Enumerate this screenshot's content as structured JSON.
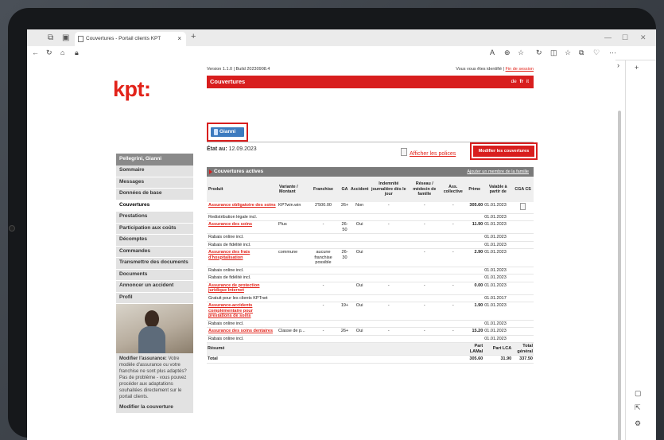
{
  "browser": {
    "tab_title": "Couvertures - Portail clients KPT",
    "tab_close": "×",
    "new_tab": "+",
    "min": "—",
    "max": "☐",
    "close": "✕"
  },
  "header": {
    "logo": "kpt:",
    "version": "Version 1.1.0 | Build 20230908.4",
    "identified_text": "Vous vous êtes identifié |",
    "logout": "Fin de session",
    "page_title": "Couvertures",
    "lang_de": "de",
    "lang_fr": "fr",
    "lang_it": "it"
  },
  "nav": {
    "user": "Pellegrini, Gianni",
    "items": [
      {
        "label": "Sommaire"
      },
      {
        "label": "Messages"
      },
      {
        "label": "Données de base"
      },
      {
        "label": "Couvertures",
        "active": true
      },
      {
        "label": "Prestations"
      },
      {
        "label": "Participation aux coûts"
      },
      {
        "label": "Décomptes"
      },
      {
        "label": "Commandes"
      },
      {
        "label": "Transmettre des documents"
      },
      {
        "label": "Documents"
      },
      {
        "label": "Annoncer un accident"
      },
      {
        "label": "Profil"
      }
    ],
    "promo_title": "Modifier l'assurance:",
    "promo_text": "Votre modèle d'assurance ou votre franchise ne sont plus adaptés? Pas de problème - vous pouvez procéder aux adaptations souhaitées directement sur le portail clients.",
    "promo_link": "Modifier la couverture"
  },
  "content": {
    "person_tab": "Gianni",
    "etat_label": "État au:",
    "etat_date": "12.09.2023",
    "afficher": "Afficher les polices",
    "modify_button": "Modifier les couvertures",
    "table_title": "Couvertures actives",
    "add_member": "Ajouter un membre de la famille",
    "columns": [
      "Produit",
      "Variante / Montant",
      "Franchise",
      "GA",
      "Accident",
      "Indemnité journalière dès le jour",
      "Réseau / médecin de famille",
      "Ass. collective",
      "Prime",
      "Valable à partir de",
      "CGA CS"
    ],
    "rows": [
      {
        "product": "Assurance obligatoire des soins",
        "link": true,
        "variant": "KPTwin.win",
        "franchise": "2'500.00",
        "ga": "26+",
        "accident": "Non",
        "indem": "-",
        "reseau": "-",
        "ass": "-",
        "prime": "305.60",
        "valable": "01.01.2023",
        "cga": true
      },
      {
        "product": "Redistribution légale incl.",
        "link": false,
        "valable": "01.01.2023"
      },
      {
        "product": "Assurance des soins",
        "link": true,
        "variant": "Plus",
        "franchise": "-",
        "ga": "26-50",
        "accident": "Oui",
        "indem": "-",
        "reseau": "-",
        "ass": "-",
        "prime": "11.90",
        "valable": "01.01.2023"
      },
      {
        "product": "Rabais online incl.",
        "link": false,
        "valable": "01.01.2023"
      },
      {
        "product": "Rabais de fidélité incl.",
        "link": false,
        "valable": "01.01.2023"
      },
      {
        "product": "Assurance des frais d'hospitalisation",
        "link": true,
        "variant": "commune",
        "franchise": "aucune franchise possible",
        "ga": "26-30",
        "accident": "Oui",
        "indem": "",
        "reseau": "-",
        "ass": "-",
        "prime": "2.90",
        "valable": "01.01.2023"
      },
      {
        "product": "Rabais online incl.",
        "link": false,
        "valable": "01.01.2023"
      },
      {
        "product": "Rabais de fidélité incl.",
        "link": false,
        "valable": "01.01.2023"
      },
      {
        "product": "Assurance de protection juridique Internet",
        "link": true,
        "variant": "",
        "franchise": "-",
        "ga": "",
        "accident": "Oui",
        "indem": "-",
        "reseau": "-",
        "ass": "-",
        "prime": "0.00",
        "valable": "01.01.2023"
      },
      {
        "product": "Gratuit pour les clients KPTnet",
        "link": false,
        "valable": "01.01.2017"
      },
      {
        "product": "Assurance-accidents complémentaire pour prestations de soins",
        "link": true,
        "variant": "",
        "franchise": "-",
        "ga": "19+",
        "accident": "Oui",
        "indem": "-",
        "reseau": "-",
        "ass": "-",
        "prime": "1.90",
        "valable": "01.01.2023"
      },
      {
        "product": "Rabais online incl.",
        "link": false,
        "valable": "01.01.2023"
      },
      {
        "product": "Assurance des soins dentaires",
        "link": true,
        "variant": "Classe de p...",
        "franchise": "-",
        "ga": "26+",
        "accident": "Oui",
        "indem": "-",
        "reseau": "-",
        "ass": "-",
        "prime": "15.20",
        "valable": "01.01.2023"
      },
      {
        "product": "Rabais online incl.",
        "link": false,
        "valable": "01.01.2023"
      }
    ],
    "summary": {
      "label": "Résumé",
      "col1": "Part LAMal",
      "col2": "Part LCA",
      "col3": "Total général"
    },
    "total": {
      "label": "Total",
      "lamal": "305.60",
      "lca": "31.90",
      "general": "337.50"
    }
  }
}
